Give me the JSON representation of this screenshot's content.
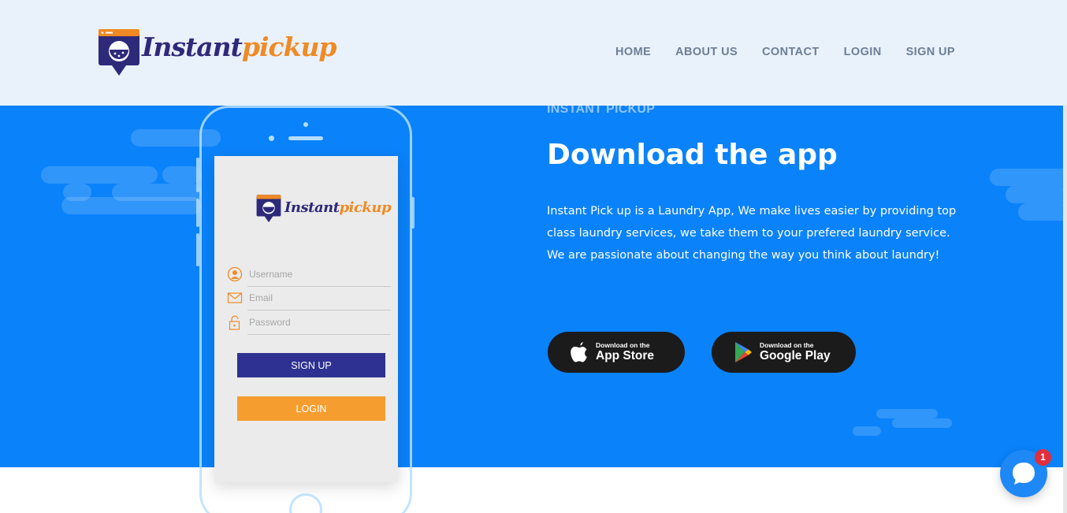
{
  "brand": {
    "name_part1": "Instant",
    "name_part2": "pickup"
  },
  "nav": {
    "items": [
      {
        "label": "HOME"
      },
      {
        "label": "ABOUT US"
      },
      {
        "label": "CONTACT"
      },
      {
        "label": "LOGIN"
      },
      {
        "label": "SIGN UP"
      }
    ]
  },
  "hero": {
    "eyebrow": "INSTANT PICKUP",
    "title": "Download the app",
    "description": "Instant Pick up is a Laundry App, We make lives easier by providing top class laundry services, we take them to your prefered laundry service. We are passionate about changing the way you think about laundry!",
    "app_store": {
      "small": "Download on the",
      "big": "App Store",
      "icon": "apple-icon"
    },
    "google_play": {
      "small": "Download on the",
      "big": "Google Play",
      "icon": "google-play-icon"
    }
  },
  "phone": {
    "logo_part1": "Instant",
    "logo_part2": "pickup",
    "fields": [
      {
        "placeholder": "Username",
        "icon": "user-icon"
      },
      {
        "placeholder": "Email",
        "icon": "mail-icon"
      },
      {
        "placeholder": "Password",
        "icon": "lock-icon"
      }
    ],
    "signup_label": "SIGN UP",
    "login_label": "LOGIN"
  },
  "chat": {
    "badge": "1",
    "icon": "chat-bubble-icon"
  },
  "colors": {
    "hero_bg": "#0a82fa",
    "header_bg": "#e9f1fb",
    "brand_navy": "#2e2a7a",
    "brand_orange": "#f08a24",
    "signup_btn": "#2e3192",
    "login_btn": "#f59e2f"
  }
}
